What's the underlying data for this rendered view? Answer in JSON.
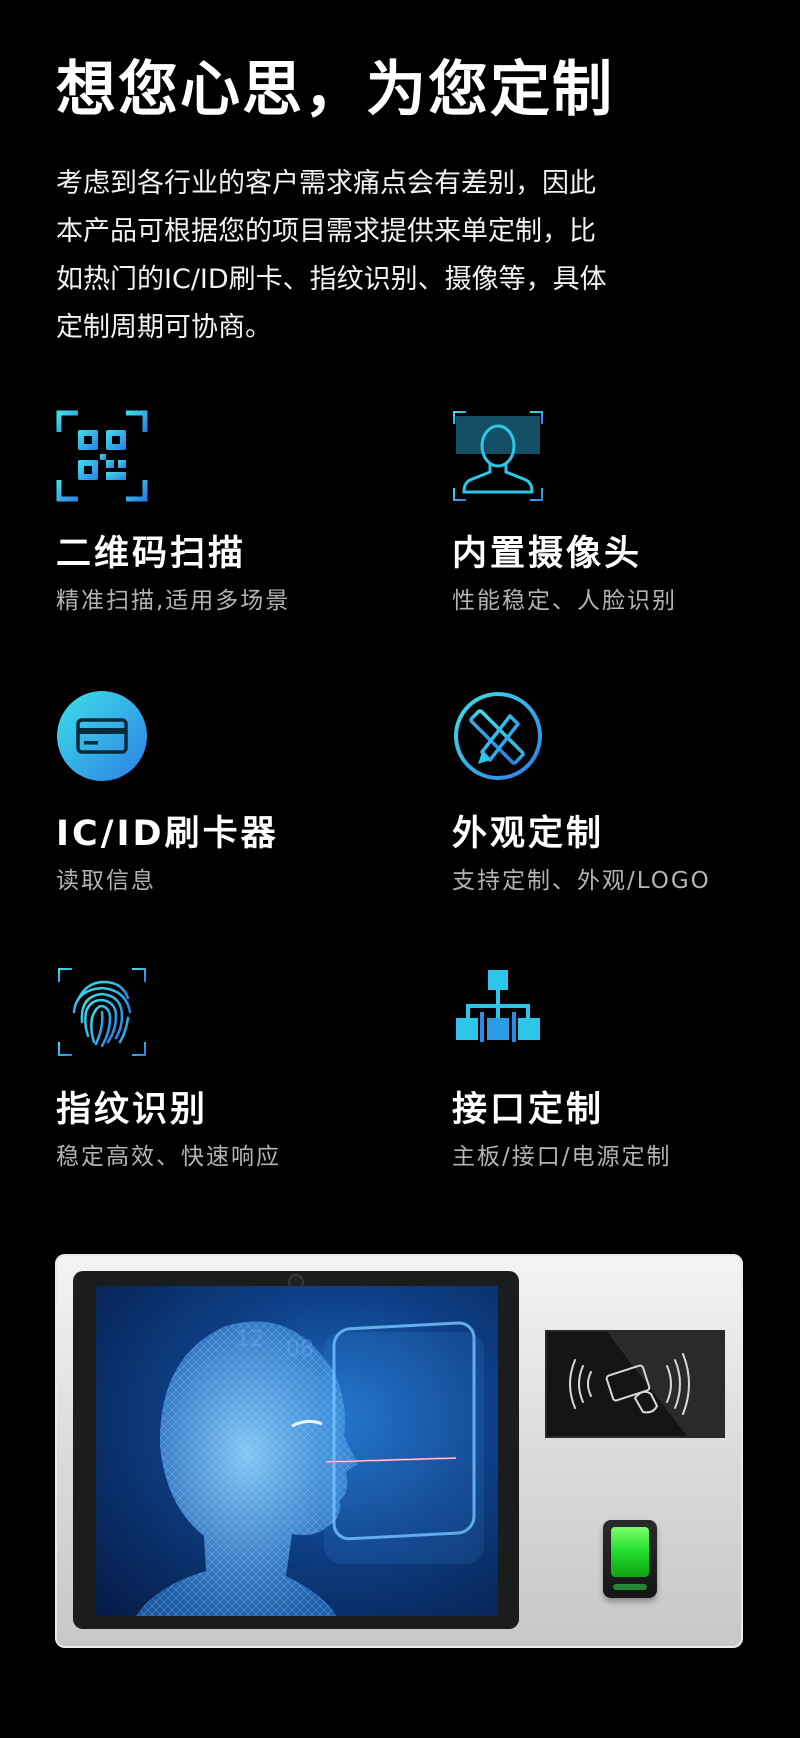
{
  "header": {
    "title": "想您心思，为您定制",
    "intro_lines": [
      "考虑到各行业的客户需求痛点会有差别，因此",
      "本产品可根据您的项目需求提供来单定制，比",
      "如热门的IC/ID刷卡、指纹识别、摄像等，具体",
      "定制周期可协商。"
    ]
  },
  "features": [
    {
      "icon": "qr-code-scan-icon",
      "title": "二维码扫描",
      "desc": "精准扫描,适用多场景"
    },
    {
      "icon": "face-camera-icon",
      "title": "内置摄像头",
      "desc": "性能稳定、人脸识别"
    },
    {
      "icon": "id-card-icon",
      "title": "IC/ID刷卡器",
      "desc": "读取信息"
    },
    {
      "icon": "design-pencil-ruler-icon",
      "title": "外观定制",
      "desc": "支持定制、外观/LOGO"
    },
    {
      "icon": "fingerprint-icon",
      "title": "指纹识别",
      "desc": "稳定高效、快速响应"
    },
    {
      "icon": "interface-network-icon",
      "title": "接口定制",
      "desc": "主板/接口/电源定制"
    }
  ],
  "device": {
    "screen_numbers": [
      "12",
      "08"
    ]
  },
  "colors": {
    "background": "#000000",
    "accent_cyan": "#2ec6e8",
    "accent_blue": "#2b8be6",
    "fingerprint_green": "#2be33a"
  }
}
